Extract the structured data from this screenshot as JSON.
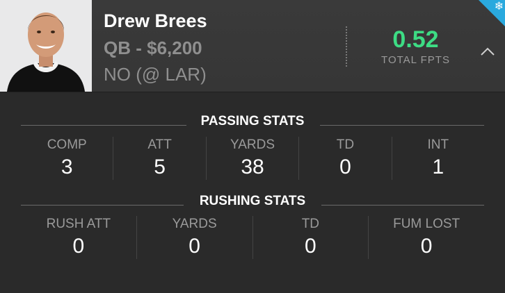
{
  "player": {
    "name": "Drew Brees",
    "position_salary": "QB - $6,200",
    "matchup": "NO (@ LAR)"
  },
  "fpts": {
    "value": "0.52",
    "label": "TOTAL FPTS"
  },
  "icons": {
    "expand": "chevron-up-icon",
    "status": "snowflake-icon"
  },
  "colors": {
    "fpts": "#3ddc84",
    "status_corner": "#2aa9de",
    "background": "#2a2a2a"
  },
  "passing": {
    "title": "PASSING STATS",
    "stats": [
      {
        "label": "COMP",
        "value": "3"
      },
      {
        "label": "ATT",
        "value": "5"
      },
      {
        "label": "YARDS",
        "value": "38"
      },
      {
        "label": "TD",
        "value": "0"
      },
      {
        "label": "INT",
        "value": "1"
      }
    ]
  },
  "rushing": {
    "title": "RUSHING STATS",
    "stats": [
      {
        "label": "RUSH ATT",
        "value": "0"
      },
      {
        "label": "YARDS",
        "value": "0"
      },
      {
        "label": "TD",
        "value": "0"
      },
      {
        "label": "FUM LOST",
        "value": "0"
      }
    ]
  }
}
